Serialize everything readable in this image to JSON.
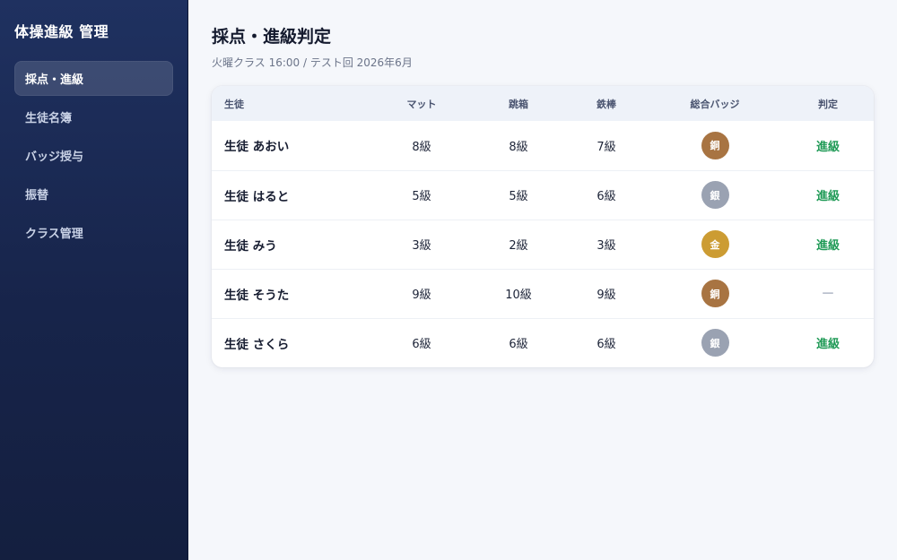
{
  "sidebar": {
    "title": "体操進級 管理",
    "items": [
      {
        "label": "採点・進級",
        "active": true
      },
      {
        "label": "生徒名簿",
        "active": false
      },
      {
        "label": "バッジ授与",
        "active": false
      },
      {
        "label": "振替",
        "active": false
      },
      {
        "label": "クラス管理",
        "active": false
      }
    ]
  },
  "header": {
    "title": "採点・進級判定",
    "subtitle": "火曜クラス 16:00 / テスト回 2026年6月"
  },
  "table": {
    "columns": [
      "生徒",
      "マット",
      "跳箱",
      "鉄棒",
      "総合バッジ",
      "判定"
    ],
    "rows": [
      {
        "name": "生徒 あおい",
        "mat": "8級",
        "vault": "8級",
        "bar": "7級",
        "badge": "銅",
        "badge_color": "#a87442",
        "result": "進級",
        "result_type": "pass"
      },
      {
        "name": "生徒 はると",
        "mat": "5級",
        "vault": "5級",
        "bar": "6級",
        "badge": "銀",
        "badge_color": "#9aa2b2",
        "result": "進級",
        "result_type": "pass"
      },
      {
        "name": "生徒 みう",
        "mat": "3級",
        "vault": "2級",
        "bar": "3級",
        "badge": "金",
        "badge_color": "#cc9c33",
        "result": "進級",
        "result_type": "pass"
      },
      {
        "name": "生徒 そうた",
        "mat": "9級",
        "vault": "10級",
        "bar": "9級",
        "badge": "銅",
        "badge_color": "#a87442",
        "result": "—",
        "result_type": "none"
      },
      {
        "name": "生徒 さくら",
        "mat": "6級",
        "vault": "6級",
        "bar": "6級",
        "badge": "銀",
        "badge_color": "#9aa2b2",
        "result": "進級",
        "result_type": "pass"
      }
    ]
  },
  "colors": {
    "pass": "#1f9a56",
    "sidebar_bg": "#1f3160"
  }
}
